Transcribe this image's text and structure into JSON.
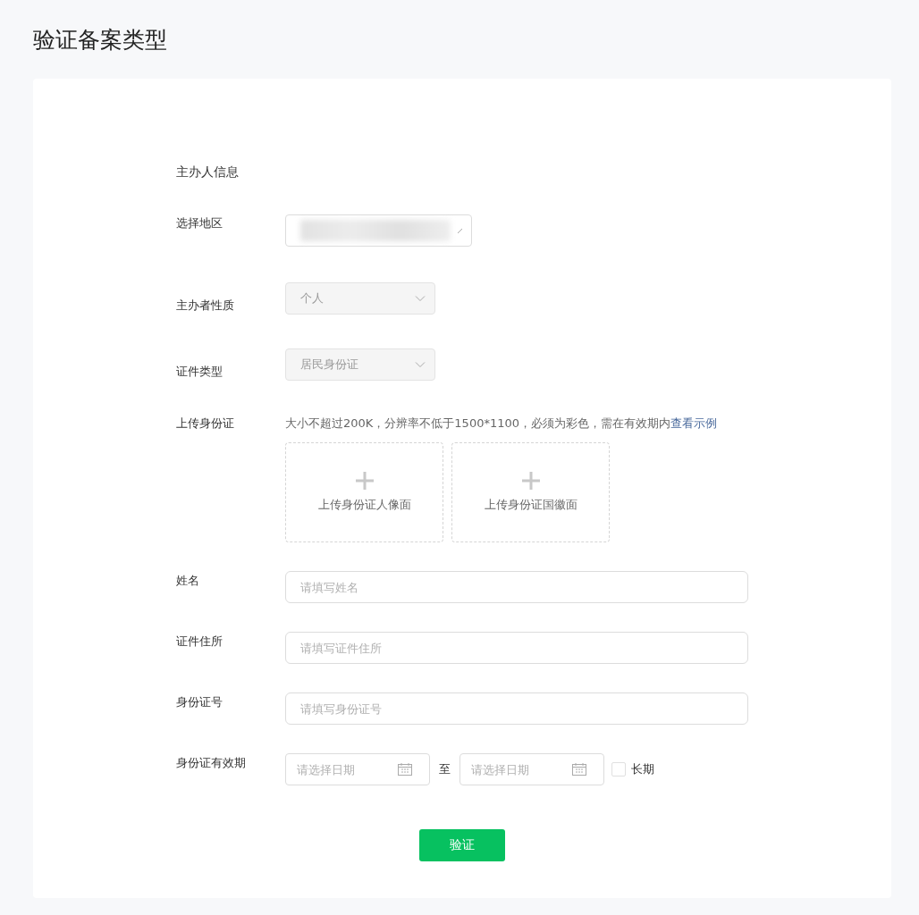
{
  "page_title": "验证备案类型",
  "section_title": "主办人信息",
  "fields": [
    {
      "kind": "region",
      "label": "选择地区"
    },
    {
      "kind": "select",
      "label": "主办者性质",
      "value": "个人",
      "disabled": true
    },
    {
      "kind": "select",
      "label": "证件类型",
      "value": "居民身份证",
      "disabled": true
    },
    {
      "kind": "upload",
      "label": "上传身份证",
      "hint": "大小不超过200K，分辨率不低于1500*1100，必须为彩色，需在有效期内",
      "hint_link": "查看示例",
      "slots": [
        "上传身份证人像面",
        "上传身份证国徽面"
      ]
    },
    {
      "kind": "text",
      "label": "姓名",
      "placeholder": "请填写姓名"
    },
    {
      "kind": "text",
      "label": "证件住所",
      "placeholder": "请填写证件住所"
    },
    {
      "kind": "text",
      "label": "身份证号",
      "placeholder": "请填写身份证号"
    },
    {
      "kind": "daterange",
      "label": "身份证有效期",
      "start_placeholder": "请选择日期",
      "separator": "至",
      "end_placeholder": "请选择日期",
      "long_term": {
        "label": "长期",
        "checked": false
      }
    }
  ],
  "submit": "验证"
}
